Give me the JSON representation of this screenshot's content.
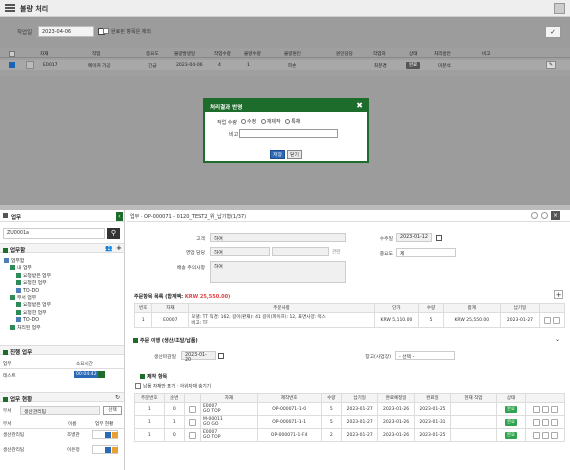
{
  "top": {
    "title": "불량 처리",
    "filter": {
      "date_label": "작업일",
      "date_value": "2023-04-06",
      "completed_label": "완료된 항목은 제외"
    },
    "grid_headers": [
      "",
      "",
      "자재",
      "작업",
      "중요도",
      "불량발생일",
      "작업수량",
      "불량수량",
      "불량원인",
      "원인담당",
      "작업자",
      "상태",
      "처리방안",
      "비고"
    ],
    "grid_row": {
      "code": "E0017",
      "job": "메이커 가공",
      "priority": "긴급",
      "date": "2023-04-06",
      "qty": "4",
      "bad_qty": "1",
      "cause": "파손",
      "owner": "",
      "worker": "최분경",
      "status": "완료",
      "plan": "미분석",
      "note": ""
    }
  },
  "modal": {
    "title": "처리결과 반영",
    "qty_label": "작업 수량",
    "options": [
      "수정",
      "재제작",
      "특채"
    ],
    "note_label": "비고",
    "save": "저장",
    "close": "닫기"
  },
  "sidebar": {
    "header": "업무",
    "search_value": "ZU0001a",
    "team_label": "업무함",
    "tree": [
      {
        "label": "업무함",
        "level": 0
      },
      {
        "label": "내 업무",
        "level": 1
      },
      {
        "label": "요청받은 업무",
        "level": 2
      },
      {
        "label": "요청한 업무",
        "level": 2
      },
      {
        "label": "TO-DO",
        "level": 2
      },
      {
        "label": "부서 업무",
        "level": 1
      },
      {
        "label": "요청받은 업무",
        "level": 2
      },
      {
        "label": "요청한 업무",
        "level": 2
      },
      {
        "label": "TO-DO",
        "level": 2
      },
      {
        "label": "처리된 업무",
        "level": 1
      }
    ],
    "progress": {
      "title": "진행 업무",
      "col1": "업무",
      "col2": "소요시간",
      "row_name": "테스트",
      "row_time": "00:04:42"
    },
    "status": {
      "title": "업무 현황",
      "filter_label": "부서",
      "filter_value": "생산관리팀",
      "filter_btn": "선택",
      "cols": [
        "부서",
        "이름",
        "업무 현황"
      ],
      "rows": [
        {
          "dept": "생산관리팀",
          "name": "조병관"
        },
        {
          "dept": "생산관리팀",
          "name": "이은정"
        }
      ]
    }
  },
  "main": {
    "breadcrumb": "업무 · OP-000071 - 0120_TEST2_위_납기형(1/37)",
    "customer_label": "고객",
    "customer_value": "하여",
    "contact_label": "영업 담당",
    "contact_value": "하여",
    "contact_btn": "관련",
    "note_label": "배송 주의사항",
    "note_value": "하여",
    "order_date_label": "수주일",
    "order_date_value": "2023-01-12",
    "priority_label": "중요도",
    "priority_value": "제",
    "items_title": "주문항목 목록 (합계액:",
    "items_total": "KRW 25,550.00)",
    "items_cols": [
      "번호",
      "자재",
      "주문사항",
      "단가",
      "수량",
      "합계",
      "납기일"
    ],
    "items_row": {
      "no": "1",
      "code": "E0007",
      "spec": "모델: TT 직경: 162, 길이(판재): 41 길이(파이프): 12, 표면사양: 럭스",
      "spec2": "비고: TF",
      "price": "KRW 5,110.00",
      "qty": "5",
      "total": "KRW 25,550.00",
      "due": "2023-01-27"
    },
    "prod_title": "주문 이행 (생산/조달/납품)",
    "prod_date_label": "생산마감일",
    "prod_date_value": "2023-01-20",
    "warehouse_label": "창고(사업장)",
    "warehouse_value": "- 선택 -",
    "work_title": "제작 항목",
    "work_filter": "납품 자재만 표기 · 하위자재 숨기기",
    "work_cols": [
      "주문번호",
      "순번",
      "",
      "자재",
      "제작번호",
      "수량",
      "납기일",
      "완료예정일",
      "완료일",
      "현재 작업",
      "상태",
      ""
    ],
    "work_rows": [
      {
        "ord": "1",
        "seq": "0",
        "code": "E0007",
        "name": "GO TOP",
        "mfg": "OP-000071-1-0",
        "qty": "5",
        "due": "2023-01-27",
        "plan": "2023-01-26",
        "done": "2023-01-25",
        "cur": "",
        "status": "완료"
      },
      {
        "ord": "1",
        "seq": "1",
        "code": "M-00011",
        "name": "GO GO",
        "mfg": "OP-000071-1-1",
        "qty": "5",
        "due": "2023-01-27",
        "plan": "2023-01-26",
        "done": "2023-01-31",
        "cur": "",
        "status": "완료"
      },
      {
        "ord": "1",
        "seq": "0",
        "code": "E0007",
        "name": "GO TOP",
        "mfg": "OP-000071-1-F4",
        "qty": "2",
        "due": "2023-01-27",
        "plan": "2023-01-26",
        "done": "2023-01-25",
        "cur": "",
        "status": "완료"
      }
    ]
  },
  "colors": {
    "green": "#1e6c2c",
    "blue": "#2a69b6",
    "ok": "#2ea44f",
    "overlay": "#9c9c9c"
  }
}
